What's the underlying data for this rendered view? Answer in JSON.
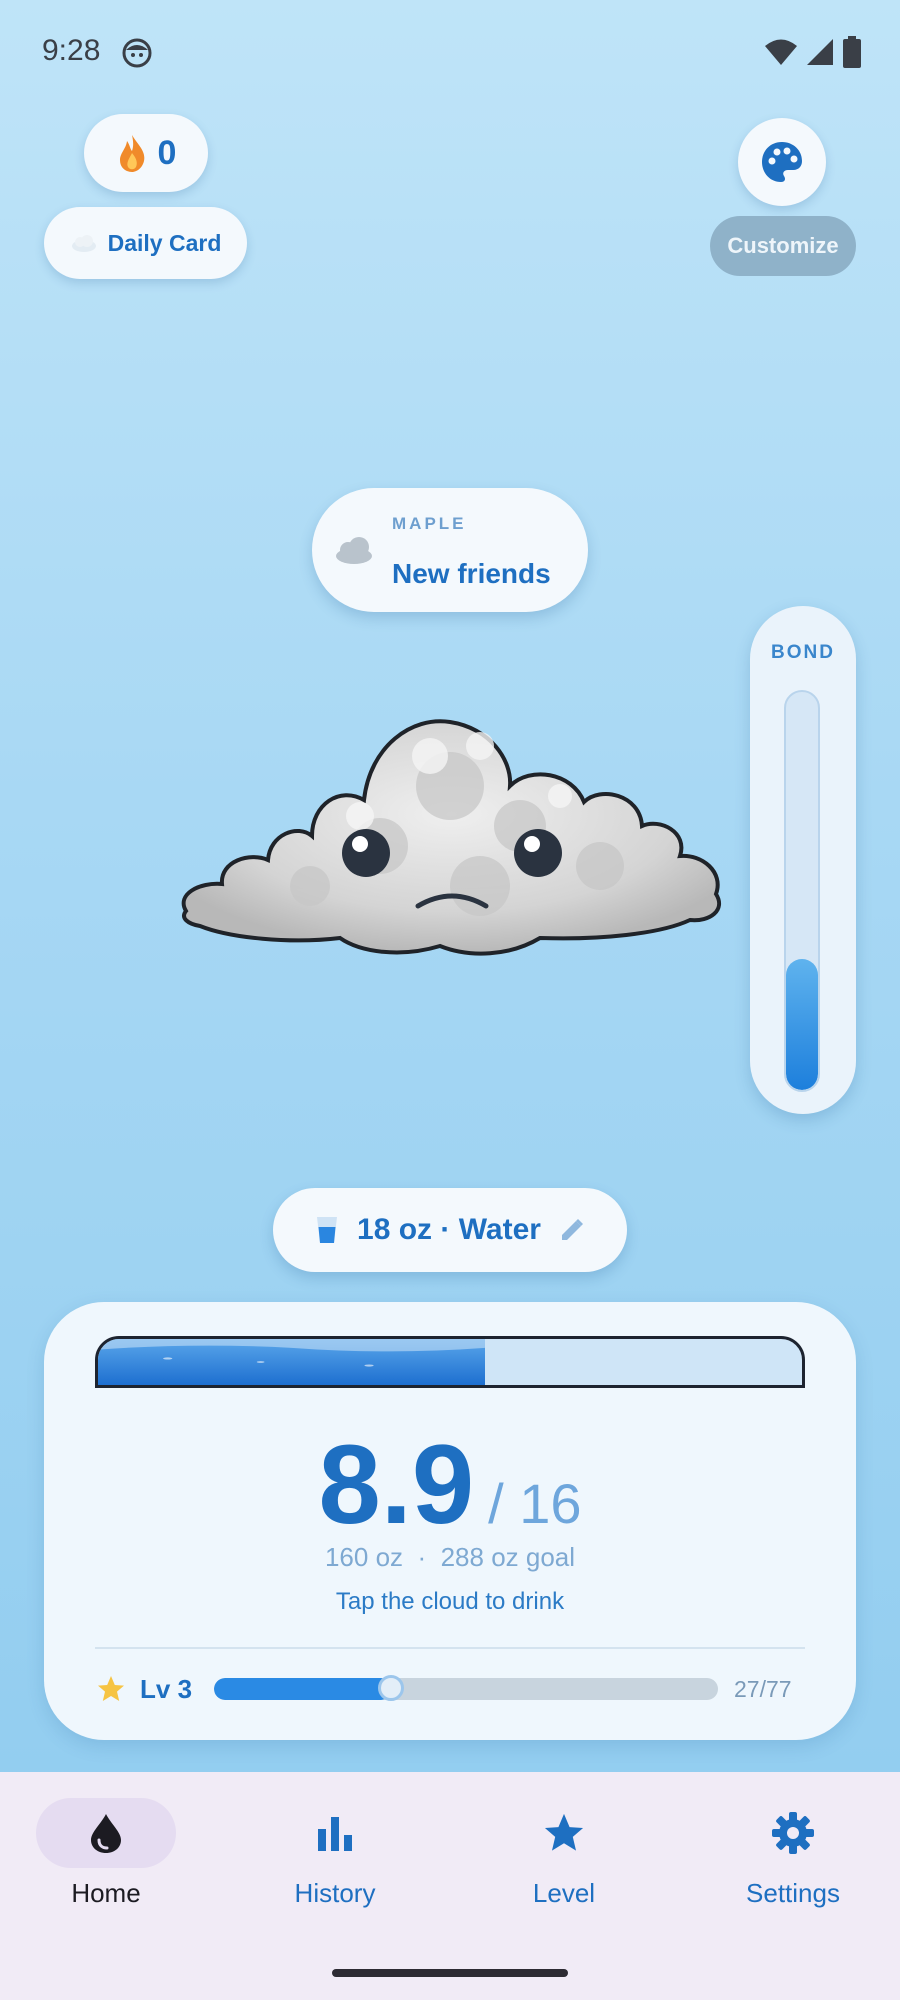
{
  "status": {
    "time": "9:28"
  },
  "streak": {
    "count": "0"
  },
  "daily": {
    "label": "Daily Card"
  },
  "customize": {
    "label": "Customize"
  },
  "speech": {
    "name": "MAPLE",
    "message": "New friends"
  },
  "bond": {
    "label": "BOND",
    "level_fraction": 0.33
  },
  "drink": {
    "label": "18 oz · Water"
  },
  "progress": {
    "fill_fraction": 0.55,
    "value": "8.9",
    "goal": "/ 16",
    "oz_line": "160 oz  ·  288 oz goal",
    "hint": "Tap the cloud to drink"
  },
  "level": {
    "label": "Lv 3",
    "xp_text": "27/77",
    "xp_fraction": 0.3506
  },
  "nav": {
    "items": [
      {
        "label": "Home",
        "icon": "water-drop-icon",
        "active": true
      },
      {
        "label": "History",
        "icon": "bar-chart-icon",
        "active": false
      },
      {
        "label": "Level",
        "icon": "star-icon",
        "active": false
      },
      {
        "label": "Settings",
        "icon": "gear-icon",
        "active": false
      }
    ]
  },
  "colors": {
    "accent": "#1e6fc1",
    "nav_bg": "#f1ebf6",
    "active_pill": "#e5dcf1"
  }
}
